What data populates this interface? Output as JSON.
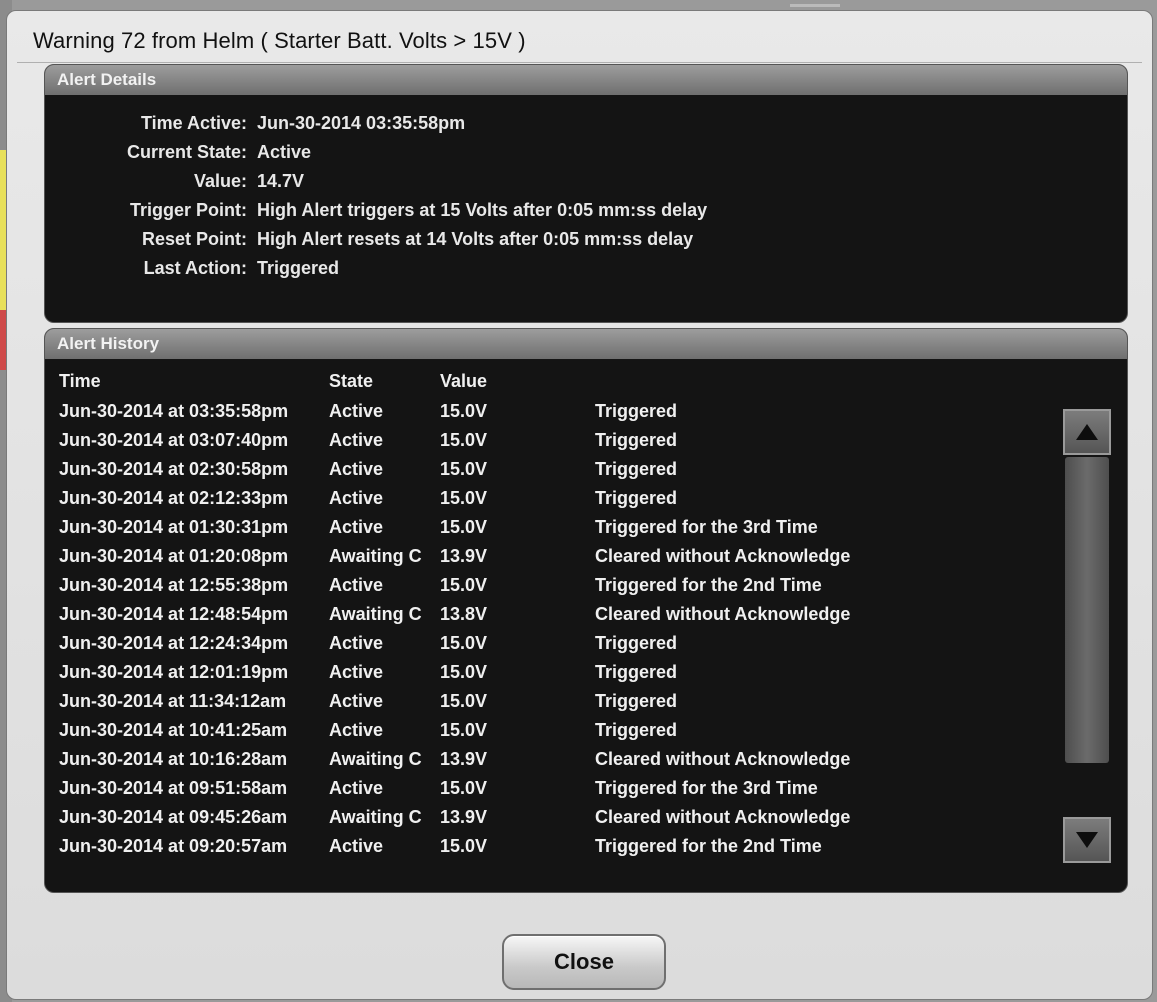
{
  "dialog": {
    "title": "Warning 72 from Helm ( Starter Batt. Volts > 15V )",
    "close_label": "Close"
  },
  "details": {
    "header": "Alert Details",
    "rows": [
      {
        "label": "Time Active:",
        "value": "Jun-30-2014 03:35:58pm"
      },
      {
        "label": "Current State:",
        "value": "Active"
      },
      {
        "label": "Value:",
        "value": "14.7V"
      },
      {
        "label": "Trigger Point:",
        "value": "High Alert triggers at 15 Volts after 0:05 mm:ss delay"
      },
      {
        "label": "Reset Point:",
        "value": "High Alert resets at 14 Volts after 0:05 mm:ss delay"
      },
      {
        "label": "Last Action:",
        "value": "Triggered"
      }
    ]
  },
  "history": {
    "header": "Alert History",
    "columns": {
      "time": "Time",
      "state": "State",
      "value": "Value"
    },
    "rows": [
      {
        "time": "Jun-30-2014 at 03:35:58pm",
        "state": "Active",
        "value": "15.0V",
        "action": "Triggered"
      },
      {
        "time": "Jun-30-2014 at 03:07:40pm",
        "state": "Active",
        "value": "15.0V",
        "action": "Triggered"
      },
      {
        "time": "Jun-30-2014 at 02:30:58pm",
        "state": "Active",
        "value": "15.0V",
        "action": "Triggered"
      },
      {
        "time": "Jun-30-2014 at 02:12:33pm",
        "state": "Active",
        "value": "15.0V",
        "action": "Triggered"
      },
      {
        "time": "Jun-30-2014 at 01:30:31pm",
        "state": "Active",
        "value": "15.0V",
        "action": "Triggered for the 3rd Time"
      },
      {
        "time": "Jun-30-2014 at 01:20:08pm",
        "state": "Awaiting C",
        "value": "13.9V",
        "action": "Cleared without Acknowledge"
      },
      {
        "time": "Jun-30-2014 at 12:55:38pm",
        "state": "Active",
        "value": "15.0V",
        "action": "Triggered for the 2nd Time"
      },
      {
        "time": "Jun-30-2014 at 12:48:54pm",
        "state": "Awaiting C",
        "value": "13.8V",
        "action": "Cleared without Acknowledge"
      },
      {
        "time": "Jun-30-2014 at 12:24:34pm",
        "state": "Active",
        "value": "15.0V",
        "action": "Triggered"
      },
      {
        "time": "Jun-30-2014 at 12:01:19pm",
        "state": "Active",
        "value": "15.0V",
        "action": "Triggered"
      },
      {
        "time": "Jun-30-2014 at 11:34:12am",
        "state": "Active",
        "value": "15.0V",
        "action": "Triggered"
      },
      {
        "time": "Jun-30-2014 at 10:41:25am",
        "state": "Active",
        "value": "15.0V",
        "action": "Triggered"
      },
      {
        "time": "Jun-30-2014 at 10:16:28am",
        "state": "Awaiting C",
        "value": "13.9V",
        "action": "Cleared without Acknowledge"
      },
      {
        "time": "Jun-30-2014 at 09:51:58am",
        "state": "Active",
        "value": "15.0V",
        "action": "Triggered for the 3rd Time"
      },
      {
        "time": "Jun-30-2014 at 09:45:26am",
        "state": "Awaiting C",
        "value": "13.9V",
        "action": "Cleared without Acknowledge"
      },
      {
        "time": "Jun-30-2014 at 09:20:57am",
        "state": "Active",
        "value": "15.0V",
        "action": "Triggered for the 2nd Time"
      }
    ],
    "scroll_up_icon": "triangle-up-icon",
    "scroll_down_icon": "triangle-down-icon"
  }
}
